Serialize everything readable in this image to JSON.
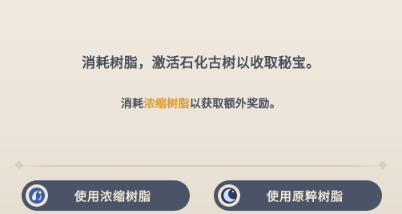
{
  "dialog": {
    "main_message": "消耗树脂，激活石化古树以收取秘宝。",
    "sub_message_prefix": "消耗",
    "sub_message_highlight": "浓缩树脂",
    "sub_message_suffix": "以获取额外奖励。"
  },
  "buttons": {
    "condensed_label": "使用浓缩树脂",
    "condensed_icon": "condensed-resin-icon",
    "original_label": "使用原粹树脂",
    "original_icon": "original-resin-moon-icon"
  },
  "colors": {
    "background": "#ece5da",
    "text": "#4a4e5c",
    "highlight": "#e39626",
    "button_bg": "#4b5366",
    "button_text": "#ece5d8"
  }
}
